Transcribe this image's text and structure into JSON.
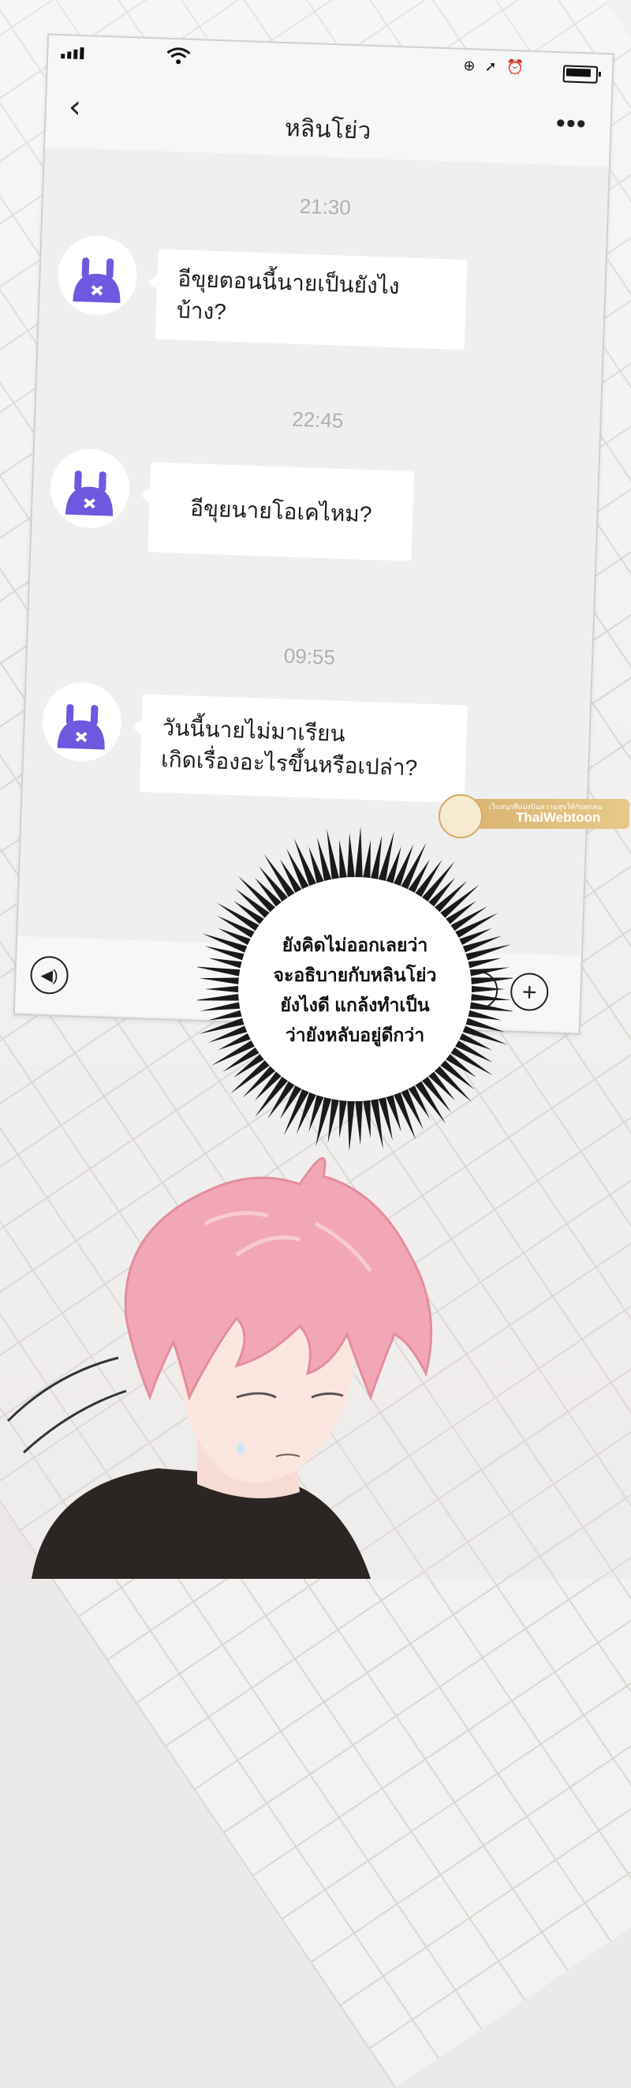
{
  "status_bar": {
    "wifi": "wifi-icon",
    "icons": [
      "rotation-lock-icon",
      "location-icon",
      "alarm-icon"
    ],
    "battery": "battery-icon"
  },
  "nav": {
    "back_icon": "chevron-left-icon",
    "title": "หลินโย่ว",
    "more_icon": "more-icon"
  },
  "messages": [
    {
      "time": "21:30",
      "lines": [
        "อีขุยตอนนี้นายเป็นยังไงบ้าง?"
      ]
    },
    {
      "time": "22:45",
      "lines": [
        "อีขุยนายโอเคไหม?"
      ]
    },
    {
      "time": "09:55",
      "lines": [
        "วันนี้นายไม่มาเรียน",
        "เกิดเรื่องอะไรขึ้นหรือเปล่า?"
      ]
    }
  ],
  "input_bar": {
    "voice_icon": "voice-icon",
    "emoji_icon": "emoji-icon",
    "plus_icon": "plus-icon"
  },
  "watermark": {
    "tagline": "เว็บสนุกที่แบ่งปันความสุขให้กับทุกคน",
    "name": "ThaiWebtoon"
  },
  "thought": {
    "lines": [
      "ยังคิดไม่ออกเลยว่า",
      "จะอธิบายกับหลินโย่ว",
      "ยังไงดี แกล้งทำเป็น",
      "ว่ายังหลับอยู่ดีกว่า"
    ]
  },
  "colors": {
    "avatar_accent": "#6e58e0",
    "hair": "#f2a7b6",
    "shirt": "#2b2624"
  }
}
